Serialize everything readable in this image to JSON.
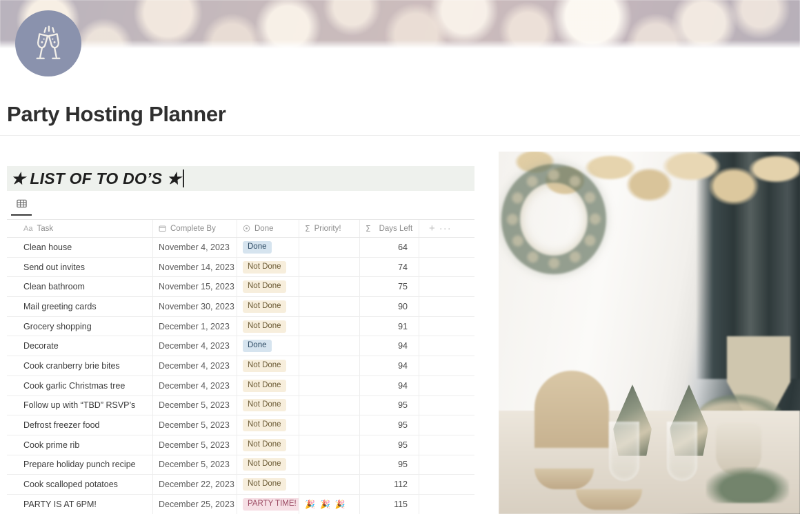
{
  "cover": {
    "name": "bokeh-lights-cover"
  },
  "page_icon": {
    "name": "clinking-champagne-glasses-icon"
  },
  "page_title": "Party Hosting Planner",
  "heading_block": {
    "text": "★ LIST OF TO DO’S ★",
    "background": "#eef1ed",
    "has_cursor": true
  },
  "view_tab": {
    "label": "table-view",
    "icon": "table-icon",
    "active": true
  },
  "table": {
    "columns": [
      {
        "key": "task",
        "label": "Task",
        "icon": "text-aa-icon"
      },
      {
        "key": "date",
        "label": "Complete By",
        "icon": "calendar-icon"
      },
      {
        "key": "done",
        "label": "Done",
        "icon": "select-circle-icon"
      },
      {
        "key": "priority",
        "label": "Priority!",
        "icon": "formula-sigma-icon"
      },
      {
        "key": "days",
        "label": "Days Left",
        "icon": "formula-sigma-icon"
      }
    ],
    "add_column_label": "+",
    "more_options_label": "···",
    "status_colors": {
      "done": "#d6e4ef",
      "not_done": "#f7eedc",
      "party_time": "#f6dfe5"
    },
    "rows": [
      {
        "task": "Clean house",
        "date": "November 4, 2023",
        "done": "Done",
        "priority": "",
        "days": "64"
      },
      {
        "task": "Send out invites",
        "date": "November 14, 2023",
        "done": "Not Done",
        "priority": "",
        "days": "74"
      },
      {
        "task": "Clean bathroom",
        "date": "November 15, 2023",
        "done": "Not Done",
        "priority": "",
        "days": "75"
      },
      {
        "task": "Mail greeting cards",
        "date": "November 30, 2023",
        "done": "Not Done",
        "priority": "",
        "days": "90"
      },
      {
        "task": "Grocery shopping",
        "date": "December 1, 2023",
        "done": "Not Done",
        "priority": "",
        "days": "91"
      },
      {
        "task": "Decorate",
        "date": "December 4, 2023",
        "done": "Done",
        "priority": "",
        "days": "94"
      },
      {
        "task": "Cook cranberry brie bites",
        "date": "December 4, 2023",
        "done": "Not Done",
        "priority": "",
        "days": "94"
      },
      {
        "task": "Cook garlic Christmas tree",
        "date": "December 4, 2023",
        "done": "Not Done",
        "priority": "",
        "days": "94"
      },
      {
        "task": "Follow up with “TBD” RSVP’s",
        "date": "December 5, 2023",
        "done": "Not Done",
        "priority": "",
        "days": "95"
      },
      {
        "task": "Defrost freezer food",
        "date": "December 5, 2023",
        "done": "Not Done",
        "priority": "",
        "days": "95"
      },
      {
        "task": "Cook prime rib",
        "date": "December 5, 2023",
        "done": "Not Done",
        "priority": "",
        "days": "95"
      },
      {
        "task": "Prepare holiday punch recipe",
        "date": "December 5, 2023",
        "done": "Not Done",
        "priority": "",
        "days": "95"
      },
      {
        "task": "Cook scalloped potatoes",
        "date": "December 22, 2023",
        "done": "Not Done",
        "priority": "",
        "days": "112"
      },
      {
        "task": "PARTY IS AT 6PM!",
        "date": "December 25, 2023",
        "done": "PARTY TIME!",
        "priority": "🎉🎉🎉",
        "days": "115"
      }
    ]
  },
  "side_image": {
    "name": "holiday-table-setting-photo"
  }
}
